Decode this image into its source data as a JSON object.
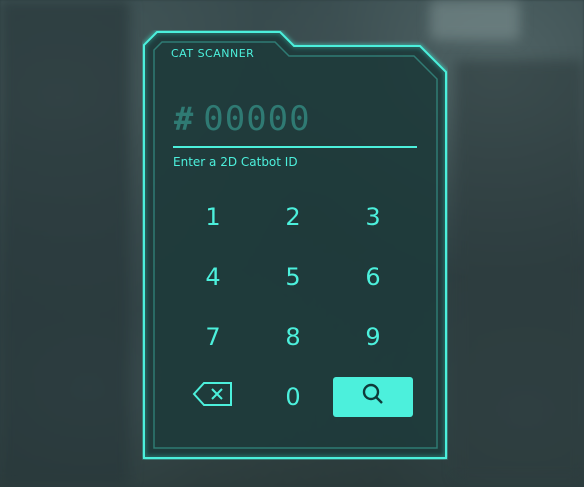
{
  "scanner": {
    "title": "CAT SCANNER",
    "id_prefix": "#",
    "id_placeholder": "00000",
    "hint": "Enter a 2D Catbot ID"
  },
  "keypad": {
    "keys": [
      "1",
      "2",
      "3",
      "4",
      "5",
      "6",
      "7",
      "8",
      "9"
    ],
    "zero": "0",
    "backspace_icon": "backspace-icon",
    "search_icon": "search-icon"
  },
  "colors": {
    "accent": "#4cf0dc",
    "dim_text": "#2f7a73",
    "panel_fill": "#1d3a3b"
  }
}
